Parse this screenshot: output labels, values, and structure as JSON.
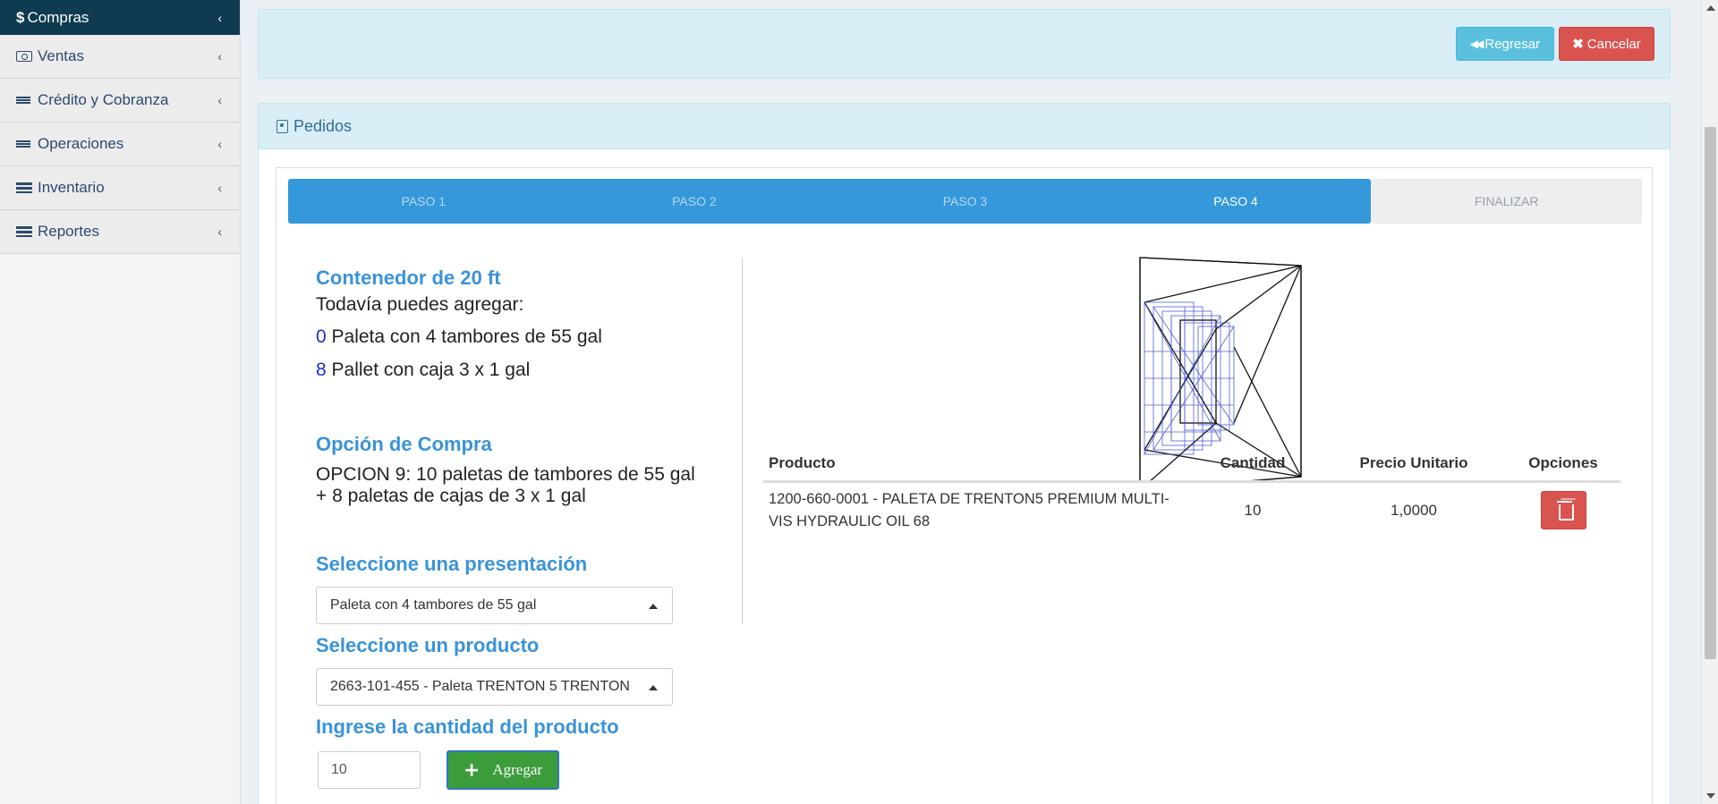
{
  "sidebar": {
    "items": [
      {
        "label": "Compras",
        "icon": "dollar-icon",
        "active": true
      },
      {
        "label": "Ventas",
        "icon": "money-icon"
      },
      {
        "label": "Crédito y Cobranza",
        "icon": "sliders-icon"
      },
      {
        "label": "Operaciones",
        "icon": "sliders-icon"
      },
      {
        "label": "Inventario",
        "icon": "tasks-icon"
      },
      {
        "label": "Reportes",
        "icon": "tasks-icon"
      }
    ]
  },
  "topbar": {
    "back_label": "Regresar",
    "cancel_label": "Cancelar"
  },
  "panel": {
    "title": "Pedidos"
  },
  "wizard": {
    "steps": [
      "PASO 1",
      "PASO 2",
      "PASO 3",
      "PASO 4",
      "FINALIZAR"
    ],
    "current_step": "PASO 4"
  },
  "container": {
    "title": "Contenedor de 20 ft",
    "subtitle": "Todavía puedes agregar:",
    "remaining": [
      {
        "count": "0",
        "label": "Paleta con 4 tambores de 55 gal"
      },
      {
        "count": "8",
        "label": "Pallet con caja 3 x 1 gal"
      }
    ]
  },
  "purchase_option": {
    "title": "Opción de Compra",
    "line1": "OPCION 9: 10 paletas de tambores de 55 gal",
    "line2": "+ 8 paletas de cajas de 3 x 1 gal"
  },
  "form": {
    "presentation_label": "Seleccione una presentación",
    "presentation_value": "Paleta con 4 tambores de 55 gal",
    "product_label": "Seleccione un producto",
    "product_value": "2663-101-455 - Paleta TRENTON 5 TRENTON",
    "quantity_label": "Ingrese la cantidad del producto",
    "quantity_value": "10",
    "add_label": "Agregar"
  },
  "table": {
    "headers": {
      "product": "Producto",
      "quantity": "Cantidad",
      "unit_price": "Precio Unitario",
      "options": "Opciones"
    },
    "rows": [
      {
        "product": "1200-660-0001 - PALETA DE TRENTON5 PREMIUM MULTI-VIS HYDRAULIC OIL 68",
        "quantity": "10",
        "unit_price": "1,0000"
      }
    ]
  },
  "colors": {
    "sidebar_active": "#0e3b4f",
    "step_done": "#3498db",
    "heading_blue": "#3a93d8",
    "danger": "#d9534f",
    "info": "#5bc0de",
    "success": "#3a9d3a"
  }
}
